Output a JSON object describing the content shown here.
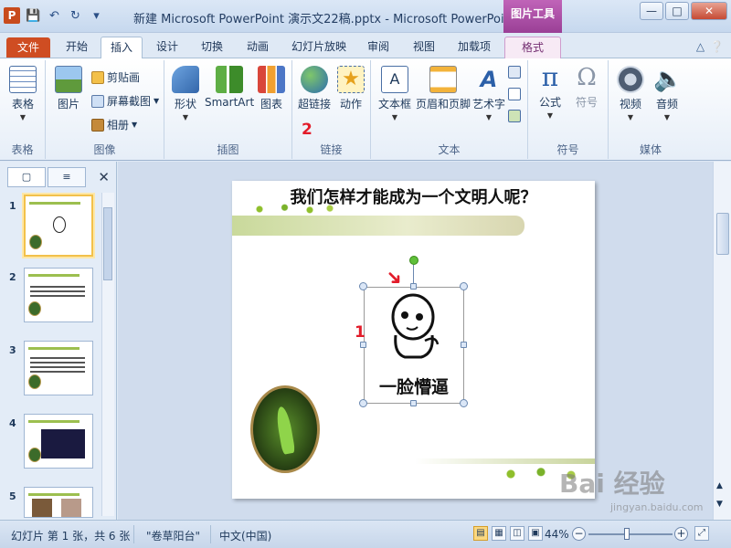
{
  "window": {
    "title": "新建 Microsoft PowerPoint 演示文22稿.pptx - Microsoft PowerPoint",
    "context_tab_group": "图片工具",
    "app_icon": "P"
  },
  "ribbon_tabs": [
    {
      "label": "文件"
    },
    {
      "label": "开始"
    },
    {
      "label": "插入"
    },
    {
      "label": "设计"
    },
    {
      "label": "切换"
    },
    {
      "label": "动画"
    },
    {
      "label": "幻灯片放映"
    },
    {
      "label": "审阅"
    },
    {
      "label": "视图"
    },
    {
      "label": "加载项"
    },
    {
      "label": "格式"
    }
  ],
  "ribbon": {
    "groups": {
      "tables": "表格",
      "images": "图像",
      "illustrations": "插图",
      "links": "链接",
      "text": "文本",
      "symbols": "符号",
      "media": "媒体"
    },
    "buttons": {
      "table": "表格",
      "picture": "图片",
      "clipart": "剪贴画",
      "screenshot": "屏幕截图",
      "album": "相册",
      "shapes": "形状",
      "smartart": "SmartArt",
      "chart": "图表",
      "hyperlink": "超链接",
      "action": "动作",
      "textbox": "文本框",
      "header_footer": "页眉和页脚",
      "wordart": "艺术字",
      "equation": "公式",
      "symbol": "符号",
      "video": "视频",
      "audio": "音频"
    }
  },
  "annotations": {
    "step1": "1",
    "step2": "2"
  },
  "slides_panel": {
    "slide_numbers": [
      "1",
      "2",
      "3",
      "4",
      "5"
    ],
    "selected": 1
  },
  "slide": {
    "title": "我们怎样才能成为一个文明人呢？",
    "caption": "一脸懵逼"
  },
  "statusbar": {
    "slide_info": "幻灯片 第 1 张，共 6 张",
    "theme": "\"卷草阳台\"",
    "language": "中文(中国)",
    "zoom": "44%"
  },
  "watermark": {
    "main": "Bai 经验",
    "sub": "jingyan.baidu.com"
  }
}
